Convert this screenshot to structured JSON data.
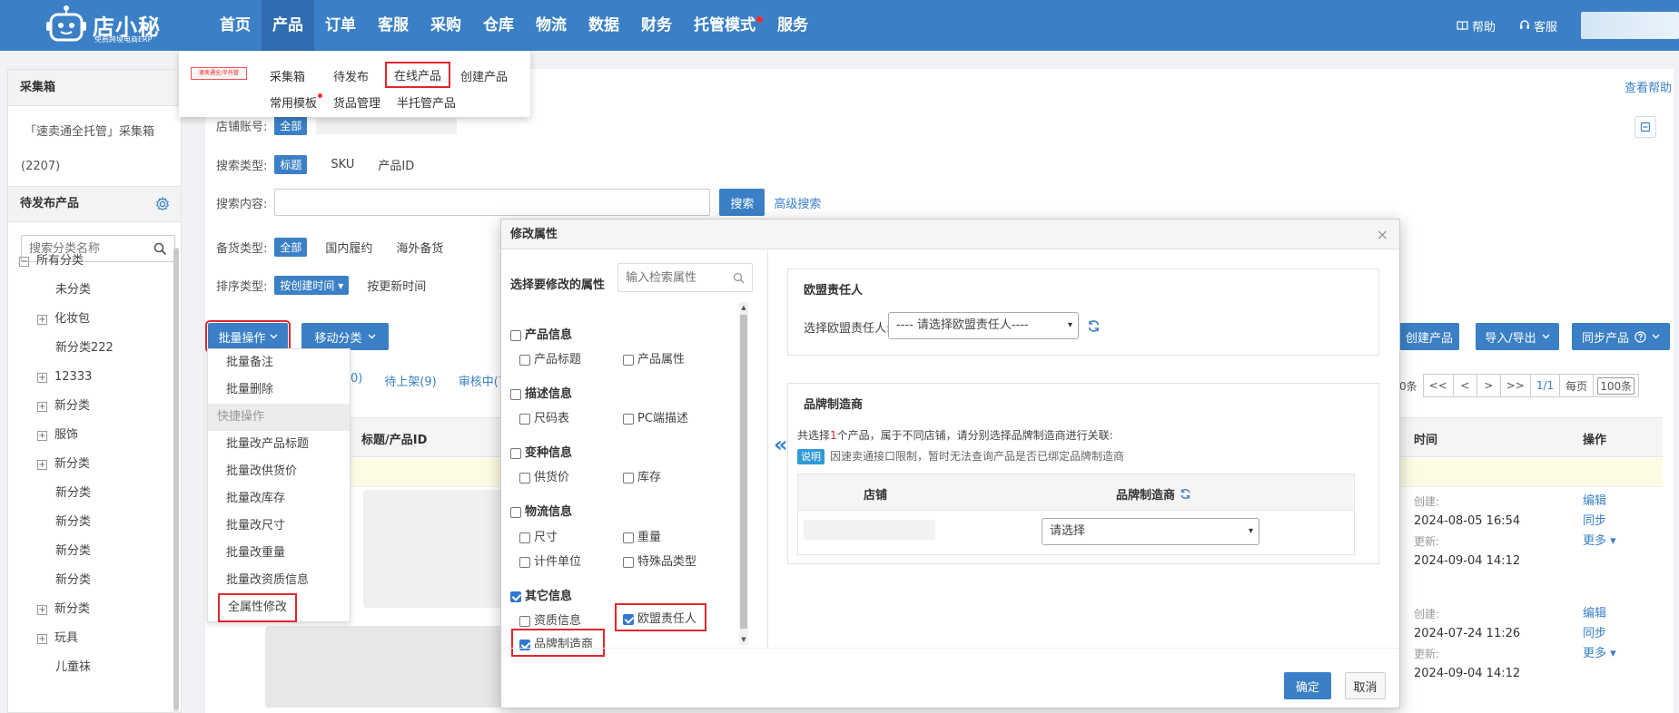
{
  "logo": {
    "brand": "店小秘",
    "slogan": "免费跨境电商ERP"
  },
  "nav": {
    "items": [
      {
        "label": "首页"
      },
      {
        "label": "产品"
      },
      {
        "label": "订单"
      },
      {
        "label": "客服"
      },
      {
        "label": "采购"
      },
      {
        "label": "仓库"
      },
      {
        "label": "物流"
      },
      {
        "label": "数据"
      },
      {
        "label": "财务"
      },
      {
        "label": "托管模式"
      },
      {
        "label": "服务"
      }
    ],
    "help": "帮助",
    "service": "客服"
  },
  "product_menu": {
    "logo_text": "速卖通全/半托管",
    "items": [
      "采集箱",
      "待发布",
      "在线产品",
      "创建产品",
      "常用模板",
      "货品管理",
      "半托管产品"
    ]
  },
  "sidebar": {
    "head1": "采集箱",
    "collect": "「速卖通全托管」采集箱",
    "collect_count": "(2207)",
    "head2": "待发布产品",
    "search_placeholder": "搜索分类名称",
    "tree": [
      "所有分类",
      "未分类",
      "化妆包",
      "新分类222",
      "12333",
      "新分类",
      "服饰",
      "新分类",
      "新分类",
      "新分类",
      "新分类",
      "新分类",
      "全属性修改"
    ],
    "tree_items": [
      {
        "label": "所有分类"
      },
      {
        "label": "未分类"
      },
      {
        "label": "化妆包"
      },
      {
        "label": "新分类222"
      },
      {
        "label": "12333"
      },
      {
        "label": "新分类"
      },
      {
        "label": "服饰"
      },
      {
        "label": "新分类"
      },
      {
        "label": "新分类"
      },
      {
        "label": "新分类"
      },
      {
        "label": "新分类"
      },
      {
        "label": "新分类"
      },
      {
        "label": "新分类"
      },
      {
        "label": "玩具"
      },
      {
        "label": "儿童袜"
      }
    ]
  },
  "main": {
    "help": "查看帮助",
    "shop_label": "店铺账号:",
    "all": "全部",
    "search_type_label": "搜索类型:",
    "search_types": [
      "标题",
      "SKU",
      "产品ID"
    ],
    "search_content_label": "搜索内容:",
    "search_btn": "搜索",
    "adv_search": "高级搜索",
    "stock_label": "备货类型:",
    "stock_types": [
      "全部",
      "国内履约",
      "海外备货"
    ],
    "sort_label": "排序类型:",
    "sort_active": "按创建时间",
    "sort_other": "按更新时间",
    "batch_btn": "批量操作",
    "move_btn": "移动分类",
    "create_btn": "创建产品",
    "import_btn": "导入/导出",
    "sync_btn": "同步产品",
    "tabs": [
      "0)",
      "待上架(9)",
      "审核中(7"
    ],
    "col_title": "标题/产品ID",
    "col_time": "时间",
    "col_op": "操作",
    "pager": {
      "count_tail": "0条",
      "first": "<<",
      "prev": "<",
      "next": ">",
      "last": ">>",
      "page": "1/1",
      "per_label": "每页",
      "per_value": "100条"
    },
    "rows": [
      {
        "created_label": "创建:",
        "created": "2024-08-05 16:54",
        "updated_label": "更新:",
        "updated": "2024-09-04 14:12",
        "ops": [
          "编辑",
          "同步",
          "更多"
        ]
      },
      {
        "created_label": "创建:",
        "created": "2024-07-24 11:26",
        "updated_label": "更新:",
        "updated": "2024-09-04 14:12",
        "ops": [
          "编辑",
          "同步",
          "更多"
        ]
      }
    ]
  },
  "batch_menu": {
    "items": [
      "批量备注",
      "批量删除"
    ],
    "group": "快捷操作",
    "quick": [
      "批量改产品标题",
      "批量改供货价",
      "批量改库存",
      "批量改尺寸",
      "批量改重量",
      "批量改资质信息",
      "全属性修改"
    ]
  },
  "modal": {
    "title": "修改属性",
    "left_title": "选择要修改的属性",
    "search_placeholder": "输入检索属性",
    "groups": [
      {
        "name": "产品信息",
        "checked": false,
        "subs": [
          {
            "name": "产品标题",
            "checked": false
          },
          {
            "name": "产品属性",
            "checked": false
          }
        ]
      },
      {
        "name": "描述信息",
        "checked": false,
        "subs": [
          {
            "name": "尺码表",
            "checked": false
          },
          {
            "name": "PC端描述",
            "checked": false
          }
        ]
      },
      {
        "name": "变种信息",
        "checked": false,
        "subs": [
          {
            "name": "供货价",
            "checked": false
          },
          {
            "name": "库存",
            "checked": false
          }
        ]
      },
      {
        "name": "物流信息",
        "checked": false,
        "subs": [
          {
            "name": "尺寸",
            "checked": false
          },
          {
            "name": "重量",
            "checked": false
          },
          {
            "name": "计件单位",
            "checked": false
          },
          {
            "name": "特殊品类型",
            "checked": false
          }
        ]
      },
      {
        "name": "其它信息",
        "checked": true,
        "subs": [
          {
            "name": "资质信息",
            "checked": false
          },
          {
            "name": "欧盟责任人",
            "checked": true
          },
          {
            "name": "品牌制造商",
            "checked": true
          }
        ]
      }
    ],
    "eu_section": {
      "title": "欧盟责任人",
      "label": "选择欧盟责任人:",
      "select": "---- 请选择欧盟责任人----"
    },
    "brand_section": {
      "title": "品牌制造商",
      "desc_pre": "共选择",
      "desc_num": "1",
      "desc_post": "个产品，属于不同店铺，请分别选择品牌制造商进行关联:",
      "tag": "说明",
      "note": "因速卖通接口限制，暂时无法查询产品是否已绑定品牌制造商",
      "col_shop": "店铺",
      "col_brand": "品牌制造商",
      "select": "请选择"
    },
    "ok": "确定",
    "cancel": "取消"
  },
  "colors": {
    "primary": "#3b80c6",
    "highlight": "#e3262c"
  }
}
